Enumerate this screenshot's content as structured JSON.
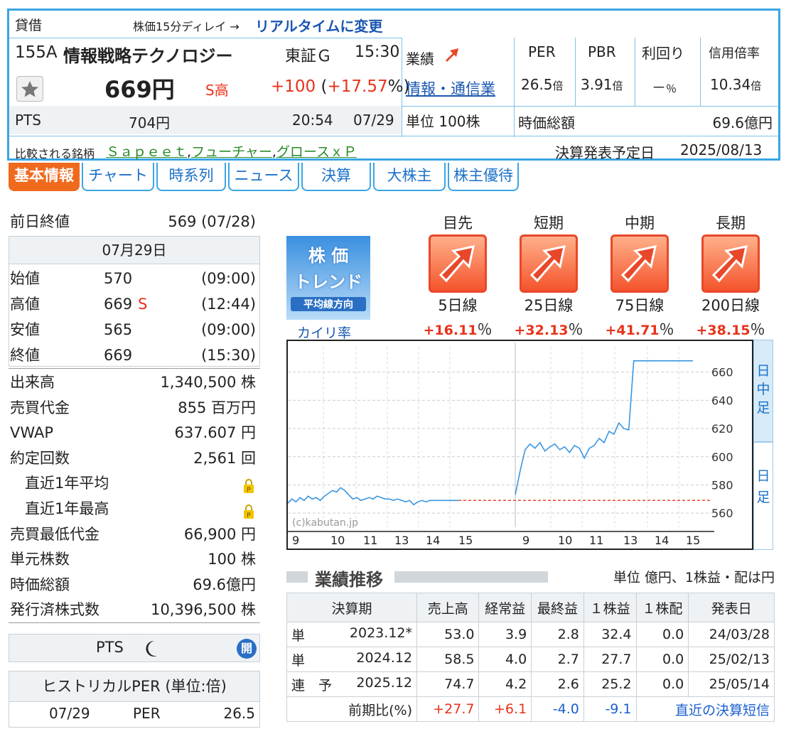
{
  "header": {
    "lending_label": "貸借",
    "delay_notice": "株価15分ディレイ →",
    "realtime_link": "リアルタイムに変更",
    "code": "155A",
    "name": "情報戦略テクノロジー",
    "market": "東証Ｇ",
    "time": "15:30",
    "price": "669円",
    "s_high": "S高",
    "change": "+100",
    "change_pct_open": "(",
    "change_pct": "+17.57",
    "change_pct_close": "%)",
    "pts_label": "PTS",
    "pts_price": "704円",
    "pts_time": "20:54",
    "pts_date": "07/29",
    "compare_label": "比較される銘柄",
    "compare": [
      "Ｓａｐｅｅｔ",
      "フューチャー",
      "グロースｘＰ"
    ],
    "gyoseki_label": "業績",
    "sector": "情報・通信業",
    "unit": "単位 100株",
    "per_label": "PER",
    "pbr_label": "PBR",
    "yield_label": "利回り",
    "margin_label": "信用倍率",
    "per": "26.5",
    "pbr": "3.91",
    "yield": "－",
    "margin": "10.34",
    "times": "倍",
    "pct": "％",
    "mcap_label": "時価総額",
    "mcap": "69.6億円",
    "earnings_label": "決算発表予定日",
    "earnings_date": "2025/08/13"
  },
  "tabs": [
    "基本情報",
    "チャート",
    "時系列",
    "ニュース",
    "決算",
    "大株主",
    "株主優待"
  ],
  "left": {
    "prev_close_label": "前日終値",
    "prev_close": "569 (07/28)",
    "date": "07月29日",
    "ohlc": [
      {
        "k": "始値",
        "v": "570",
        "t": "(09:00)"
      },
      {
        "k": "高値",
        "v": "669",
        "t": "(12:44)",
        "s": "S"
      },
      {
        "k": "安値",
        "v": "565",
        "t": "(09:00)"
      },
      {
        "k": "終値",
        "v": "669",
        "t": "(15:30)"
      }
    ],
    "stats": [
      {
        "k": "出来高",
        "v": "1,340,500 株"
      },
      {
        "k": "売買代金",
        "v": "855 百万円"
      },
      {
        "k": "VWAP",
        "v": "637.607 円"
      },
      {
        "k": "約定回数",
        "v": "2,561 回"
      },
      {
        "k": "　直近1年平均",
        "v": "",
        "lock": true
      },
      {
        "k": "　直近1年最高",
        "v": "",
        "lock": true
      },
      {
        "k": "売買最低代金",
        "v": "66,900 円"
      },
      {
        "k": "単元株数",
        "v": "100 株"
      },
      {
        "k": "時価総額",
        "v": "69.6億円"
      },
      {
        "k": "発行済株式数",
        "v": "10,396,500 株"
      }
    ],
    "pts_label": "PTS",
    "pts_open_badge": "開",
    "hist_per_title": "ヒストリカルPER (単位:倍)",
    "hist_per_date": "07/29",
    "hist_per_label": "PER",
    "hist_per_value": "26.5"
  },
  "trend": {
    "badge_lines": [
      "株 価",
      "トレンド",
      "平均線方向"
    ],
    "kairi_label": "カイリ率",
    "periods": [
      {
        "name": "目先",
        "ma": "5日線",
        "pct": "+16.11",
        "unit": "％"
      },
      {
        "name": "短期",
        "ma": "25日線",
        "pct": "+32.13",
        "unit": "％"
      },
      {
        "name": "中期",
        "ma": "75日線",
        "pct": "+41.71",
        "unit": "％"
      },
      {
        "name": "長期",
        "ma": "200日線",
        "pct": "+38.15",
        "unit": "％"
      }
    ]
  },
  "chart_data": {
    "type": "line",
    "watermark": "(c)kabutan.jp",
    "x_ticks": [
      "9",
      "10",
      "11",
      "13",
      "14",
      "15",
      "9",
      "10",
      "11",
      "13",
      "14",
      "15"
    ],
    "y_ticks": [
      560,
      580,
      600,
      620,
      640,
      660
    ],
    "ylim": [
      550,
      678
    ],
    "prev_close_line": 569,
    "side_tabs": [
      "日中足",
      "日足"
    ],
    "series": [
      {
        "day": 1,
        "values": [
          567,
          570,
          568,
          571,
          569,
          572,
          570,
          571,
          569,
          572,
          574,
          576,
          575,
          578,
          576,
          573,
          570,
          571,
          569,
          570,
          571,
          570,
          572,
          571,
          570,
          570,
          569,
          570,
          569,
          568,
          569,
          566,
          568,
          569,
          568,
          569,
          569,
          569,
          569,
          569,
          569,
          569,
          569
        ]
      },
      {
        "day": 2,
        "values": [
          573,
          590,
          605,
          609,
          606,
          610,
          604,
          607,
          609,
          605,
          607,
          603,
          608,
          606,
          599,
          606,
          608,
          613,
          610,
          618,
          616,
          624,
          620,
          619,
          668,
          668,
          668,
          668,
          668,
          668,
          668,
          668,
          668,
          668,
          668,
          668,
          668
        ]
      }
    ]
  },
  "results": {
    "title": "業績推移",
    "unit_note": "単位 億円、1株益・配は円",
    "headers": [
      "決算期",
      "売上高",
      "経常益",
      "最終益",
      "１株益",
      "１株配",
      "発表日"
    ],
    "rows": [
      {
        "kind": "単",
        "period": "2023.12*",
        "sales": "53.0",
        "ord": "3.9",
        "net": "2.8",
        "eps": "32.4",
        "div": "0.0",
        "date": "24/03/28"
      },
      {
        "kind": "単",
        "period": "2024.12",
        "sales": "58.5",
        "ord": "4.0",
        "net": "2.7",
        "eps": "27.7",
        "div": "0.0",
        "date": "25/02/13"
      },
      {
        "kind": "連　予",
        "period": "2025.12",
        "sales": "74.7",
        "ord": "4.2",
        "net": "2.6",
        "eps": "25.2",
        "div": "0.0",
        "date": "25/05/14"
      }
    ],
    "yoy_label": "前期比(%)",
    "yoy": [
      "+27.7",
      "+6.1",
      "-4.0",
      "-9.1"
    ],
    "tanshin_link": "直近の決算短信"
  },
  "colors": {
    "accent": "#3aa6e4",
    "orange": "#f06a1e",
    "red": "#e8321a",
    "blue": "#1a5fd0"
  }
}
